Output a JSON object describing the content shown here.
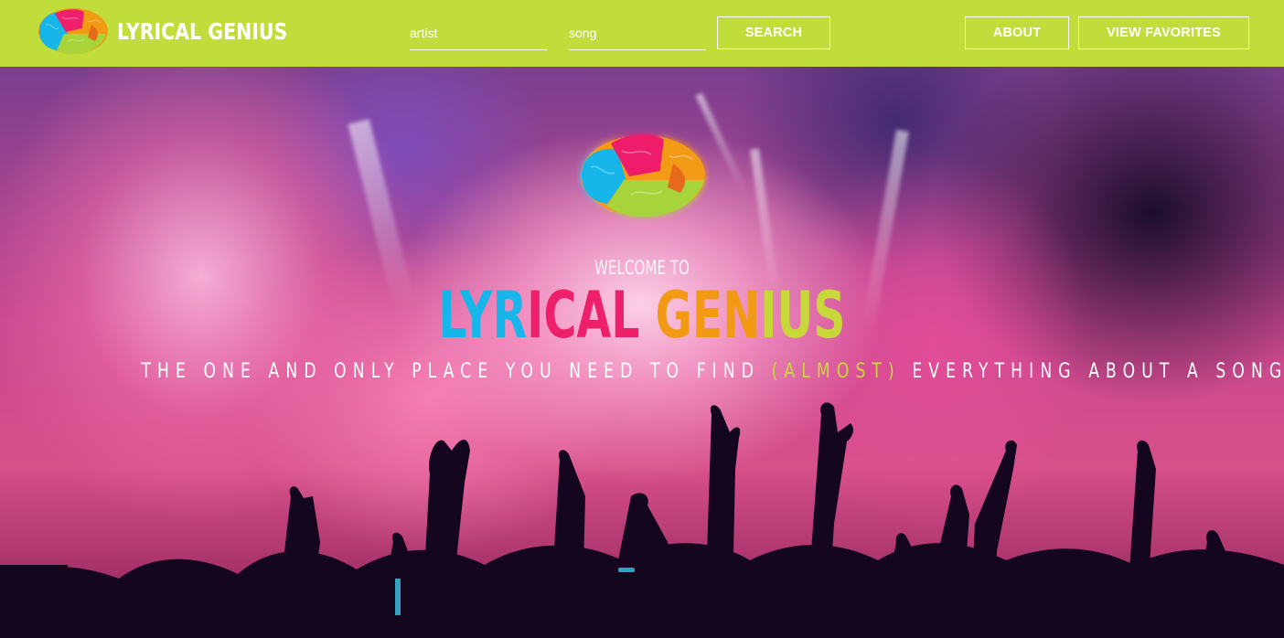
{
  "navbar": {
    "brand_text": "LYRICAL GENIUS",
    "artist_placeholder": "artist",
    "song_placeholder": "song",
    "search_label": "SEARCH",
    "about_label": "ABOUT",
    "favorites_label": "VIEW FAVORITES",
    "logo_icon": "colorful-brain-icon"
  },
  "hero": {
    "logo_icon": "colorful-brain-icon",
    "welcome": "WELCOME TO",
    "title_parts": [
      "LYR",
      "ICAL",
      " GEN",
      "IUS"
    ],
    "tagline_before": "THE ONE AND ONLY PLACE YOU NEED TO FIND ",
    "tagline_highlight": "(ALMOST)",
    "tagline_after": " EVERYTHING ABOUT A SONG.",
    "background": "concert-crowd-photo"
  },
  "colors": {
    "navbar": "#c1dd3b",
    "accent_cyan": "#16b6ea",
    "accent_pink": "#ee1f6b",
    "accent_orange": "#f39a15",
    "accent_lime": "#c8d83a"
  }
}
